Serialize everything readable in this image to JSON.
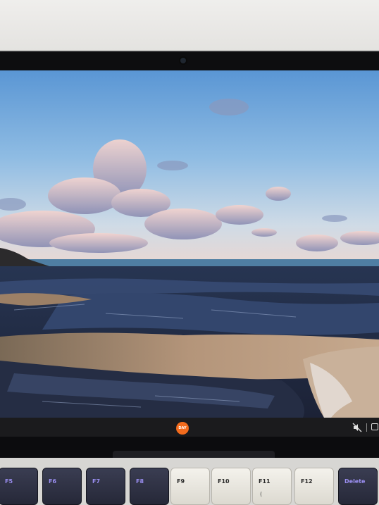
{
  "taskbar": {
    "start_label": "DAY",
    "tray_icons": [
      "mute-speaker-icon",
      "notification-icon"
    ]
  },
  "wallpaper": {
    "subject": "rocky beach at low tide under pastel sky",
    "colors": {
      "sky_top": "#5f9ad6",
      "sky_horizon": "#d9dfe6",
      "sea": "#4c7ea6",
      "rock": "#2c3a58",
      "sand": "#a58a6e"
    }
  },
  "keyboard": {
    "keys": [
      {
        "label": "F5",
        "style": "dark",
        "sub": ""
      },
      {
        "label": "F6",
        "style": "dark",
        "sub": ""
      },
      {
        "label": "F7",
        "style": "dark",
        "sub": ""
      },
      {
        "label": "F8",
        "style": "dark",
        "sub": ""
      },
      {
        "label": "F9",
        "style": "light",
        "sub": ""
      },
      {
        "label": "F10",
        "style": "light",
        "sub": ""
      },
      {
        "label": "F11",
        "style": "light",
        "sub": "("
      },
      {
        "label": "F12",
        "style": "light",
        "sub": ""
      },
      {
        "label": "Delete",
        "style": "dark",
        "sub": ""
      }
    ]
  }
}
